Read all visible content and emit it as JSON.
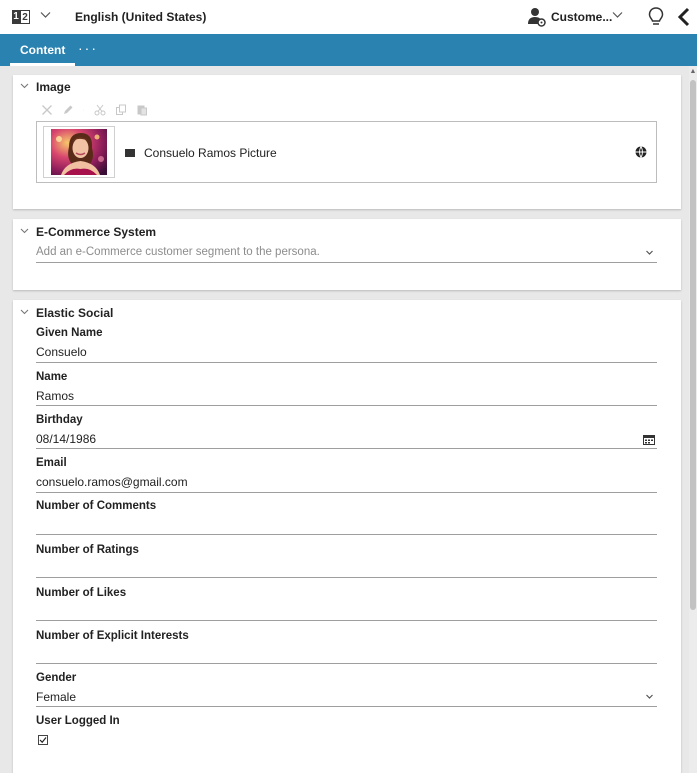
{
  "topbar": {
    "language_icon_left": "1",
    "language_icon_right": "2",
    "language": "English (United States)",
    "persona": "Custome...",
    "icons": [
      "language-icon",
      "chevron-down-icon",
      "persona-icon",
      "lightbulb-icon",
      "back-arrow-icon"
    ]
  },
  "tabs": {
    "active": "Content",
    "more": "···"
  },
  "colors": {
    "accent": "#2a82b0",
    "tab_text": "#ffffff"
  },
  "image_panel": {
    "title": "Image",
    "toolbar_icons": [
      "delete-icon",
      "edit-icon",
      "cut-icon",
      "copy-icon",
      "paste-icon"
    ],
    "picture_label": "Consuelo Ramos Picture"
  },
  "ecommerce_panel": {
    "title": "E-Commerce System",
    "placeholder": "Add an e-Commerce customer segment to the persona."
  },
  "social_panel": {
    "title": "Elastic Social",
    "fields": {
      "given_name": {
        "label": "Given Name",
        "value": "Consuelo"
      },
      "name": {
        "label": "Name",
        "value": "Ramos"
      },
      "birthday": {
        "label": "Birthday",
        "value": "08/14/1986"
      },
      "email": {
        "label": "Email",
        "value": "consuelo.ramos@gmail.com"
      },
      "comments": {
        "label": "Number of Comments",
        "value": ""
      },
      "ratings": {
        "label": "Number of Ratings",
        "value": ""
      },
      "likes": {
        "label": "Number of Likes",
        "value": ""
      },
      "interests": {
        "label": "Number of Explicit Interests",
        "value": ""
      },
      "gender": {
        "label": "Gender",
        "value": "Female"
      },
      "logged_in": {
        "label": "User Logged In",
        "checked": true
      }
    }
  }
}
